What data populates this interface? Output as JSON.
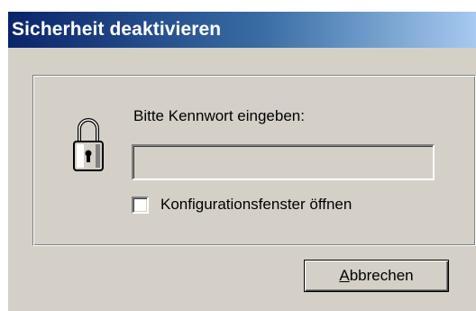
{
  "window": {
    "title": "Sicherheit deaktivieren"
  },
  "dialog": {
    "icon": "lock-icon",
    "prompt": "Bitte Kennwort eingeben:",
    "password_value": "",
    "checkbox_label": "Konfigurationsfenster öffnen",
    "checkbox_checked": false,
    "cancel_accelerator": "A",
    "cancel_rest": "bbrechen"
  },
  "colors": {
    "titlebar_start": "#0a246a",
    "titlebar_end": "#a6caf0",
    "face": "#d4d0c8"
  }
}
